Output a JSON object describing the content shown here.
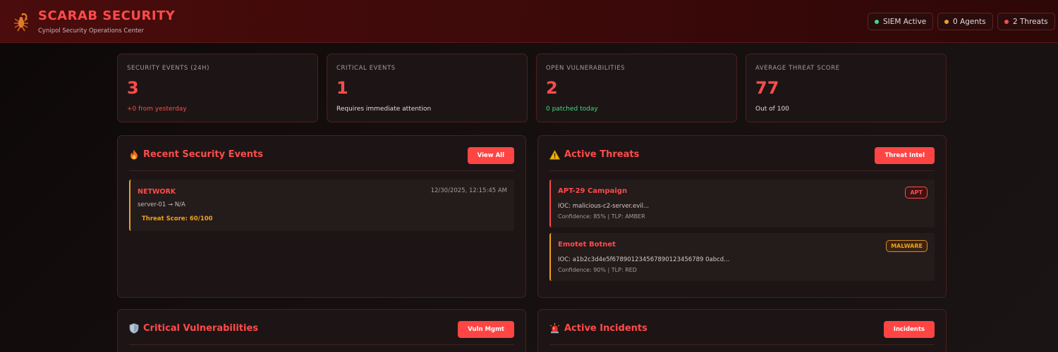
{
  "header": {
    "title": "SCARAB SECURITY",
    "subtitle": "Cynipol Security Operations Center",
    "logo_icon": "scorpion-icon",
    "status": [
      {
        "label": "SIEM Active",
        "color": "#3ddc84"
      },
      {
        "label": "0 Agents",
        "color": "#f0a020"
      },
      {
        "label": "2 Threats",
        "color": "#ff4b4b"
      }
    ]
  },
  "stats": [
    {
      "label": "SECURITY EVENTS (24H)",
      "value": "3",
      "note": "+0 from yesterday",
      "note_color": "#ff4b4b"
    },
    {
      "label": "CRITICAL EVENTS",
      "value": "1",
      "note": "Requires immediate attention",
      "note_color": "#e6d8d8"
    },
    {
      "label": "OPEN VULNERABILITIES",
      "value": "2",
      "note": "0 patched today",
      "note_color": "#3ddc84"
    },
    {
      "label": "AVERAGE THREAT SCORE",
      "value": "77",
      "note": "Out of 100",
      "note_color": "#e6d8d8"
    }
  ],
  "events_panel": {
    "icon": "fire-icon",
    "title": "Recent Security Events",
    "button": "View All",
    "events": [
      {
        "type": "NETWORK",
        "time": "12/30/2025, 12:15:45 AM",
        "route": "server-01 → N/A",
        "score": "Threat Score: 60/100"
      }
    ]
  },
  "threats_panel": {
    "icon": "warning-icon",
    "title": "Active Threats",
    "button": "Threat Intel",
    "threats": [
      {
        "name": "APT-29 Campaign",
        "badge": "APT",
        "ioc": "IOC: malicious-c2-server.evil...",
        "meta": "Confidence: 85% | TLP: AMBER"
      },
      {
        "name": "Emotet Botnet",
        "badge": "MALWARE",
        "ioc": "IOC: a1b2c3d4e5f678901234567890123456789 0abcd...",
        "meta": "Confidence: 90% | TLP: RED"
      }
    ]
  },
  "vulns_panel": {
    "icon": "shield-icon",
    "title": "Critical Vulnerabilities",
    "button": "Vuln Mgmt"
  },
  "incidents_panel": {
    "icon": "siren-icon",
    "title": "Active Incidents",
    "button": "Incidents"
  },
  "colors": {
    "accent": "#ff4b4b",
    "warning": "#f0a020",
    "success": "#3ddc84"
  }
}
